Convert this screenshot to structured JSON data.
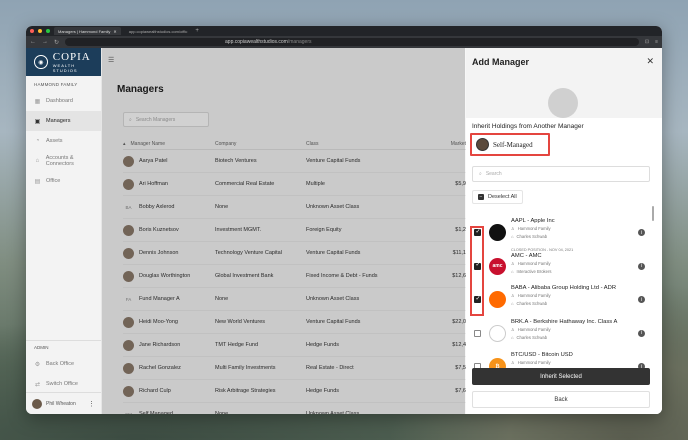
{
  "browser": {
    "tab_active": "Managers | Hammond Family",
    "tab_inactive": "app.copiawealthstudios.com/offic",
    "url_host": "app.copiawealthstudios.com",
    "url_path": "/managers"
  },
  "brand": {
    "name": "COPIA",
    "sub": "WEALTH STUDIOS"
  },
  "sidebar": {
    "family": "HAMMOND FAMILY",
    "items": [
      {
        "label": "Dashboard",
        "icon": "grid-icon"
      },
      {
        "label": "Managers",
        "icon": "briefcase-icon"
      },
      {
        "label": "Assets",
        "icon": "pie-icon"
      },
      {
        "label": "Accounts & Connectors",
        "icon": "bank-icon"
      },
      {
        "label": "Office",
        "icon": "office-icon"
      }
    ],
    "admin_title": "ADMIN",
    "admin_items": [
      {
        "label": "Back Office",
        "icon": "gear-icon"
      },
      {
        "label": "Switch Office",
        "icon": "switch-icon"
      }
    ],
    "user_name": "Phil Wheaton"
  },
  "main": {
    "title": "Managers",
    "search_placeholder": "Search Managers",
    "columns": [
      "Manager Name",
      "Company",
      "Class",
      "Market"
    ],
    "rows": [
      {
        "name": "Aarya Patel",
        "company": "Biotech Ventures",
        "class": "Venture Capital Funds",
        "value": "",
        "initials": ""
      },
      {
        "name": "Ari Hoffman",
        "company": "Commercial Real Estate",
        "class": "Multiple",
        "value": "$5,9",
        "initials": ""
      },
      {
        "name": "Bobby Axlerod",
        "company": "None",
        "class": "Unknown Asset Class",
        "value": "",
        "initials": "BA"
      },
      {
        "name": "Boris Kuznetsov",
        "company": "Investment MGMT.",
        "class": "Foreign Equity",
        "value": "$1,2",
        "initials": ""
      },
      {
        "name": "Dennis Johnson",
        "company": "Technology Venture Capital",
        "class": "Venture Capital Funds",
        "value": "$11,1",
        "initials": ""
      },
      {
        "name": "Douglas Worthington",
        "company": "Global Investment Bank",
        "class": "Fixed Income & Debt - Funds",
        "value": "$12,6",
        "initials": ""
      },
      {
        "name": "Fund Manager A",
        "company": "None",
        "class": "Unknown Asset Class",
        "value": "",
        "initials": "FA"
      },
      {
        "name": "Heidi Moo-Yong",
        "company": "New World Ventures",
        "class": "Venture Capital Funds",
        "value": "$22,0",
        "initials": ""
      },
      {
        "name": "Jane Richardson",
        "company": "TMT Hedge Fund",
        "class": "Hedge Funds",
        "value": "$12,4",
        "initials": ""
      },
      {
        "name": "Rachel Gonzalez",
        "company": "Multi Family Investments",
        "class": "Real Estate - Direct",
        "value": "$7,5",
        "initials": ""
      },
      {
        "name": "Richard Culp",
        "company": "Risk Arbitrage Strategies",
        "class": "Hedge Funds",
        "value": "$7,6",
        "initials": ""
      },
      {
        "name": "Self Managed",
        "company": "None",
        "class": "Unknown Asset Class",
        "value": "",
        "initials": "SM"
      }
    ]
  },
  "drawer": {
    "title": "Add Manager",
    "inherit_title": "Inherit Holdings from Another Manager",
    "selected_manager": "Self-Managed",
    "search_placeholder": "Search",
    "deselect_label": "Deselect All",
    "holdings": [
      {
        "tag": "",
        "name": "AAPL - Apple Inc",
        "family": "Hammond Family",
        "custodian": "Charles Schwab",
        "checked": true,
        "logo_color": "#111111",
        "logo_text": ""
      },
      {
        "tag": "CLOSED POSITION - NOV 04, 2021",
        "name": "AMC - AMC",
        "family": "Hammond Family",
        "custodian": "Interactive Brokers",
        "checked": true,
        "logo_color": "#c8102e",
        "logo_text": "amc"
      },
      {
        "tag": "",
        "name": "BABA - Alibaba Group Holding Ltd - ADR",
        "family": "Hammond Family",
        "custodian": "Charles Schwab",
        "checked": true,
        "logo_color": "#ff6a00",
        "logo_text": ""
      },
      {
        "tag": "",
        "name": "BRK.A - Berkshire Hathaway Inc. Class A",
        "family": "Hammond Family",
        "custodian": "Charles Schwab",
        "checked": false,
        "logo_color": "#ffffff",
        "logo_text": ""
      },
      {
        "tag": "",
        "name": "BTC/USD - Bitcoin USD",
        "family": "Hammond Family",
        "custodian": "Charles Schwab",
        "checked": false,
        "logo_color": "#f7931a",
        "logo_text": "₿"
      }
    ],
    "inherit_button": "Inherit Selected",
    "back_button": "Back"
  }
}
